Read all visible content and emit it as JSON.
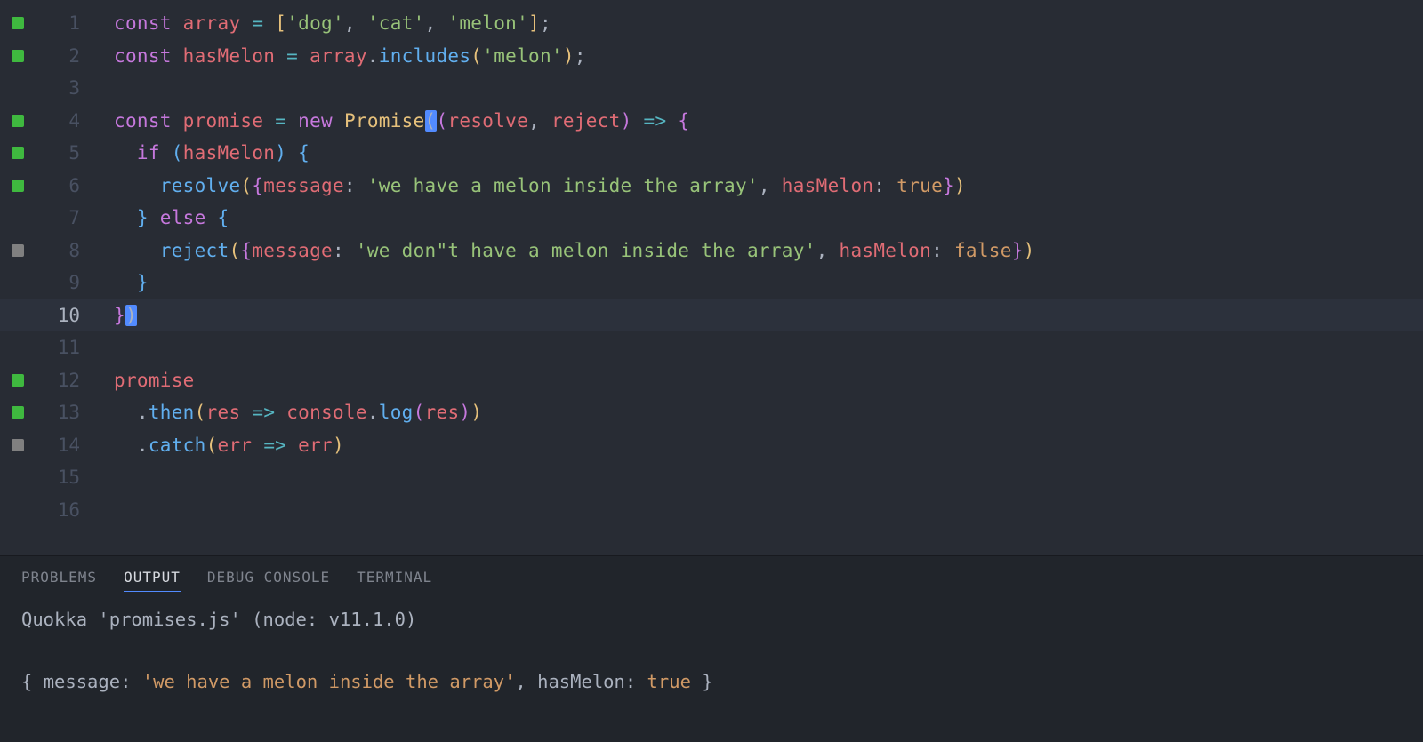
{
  "editor": {
    "lines": [
      {
        "num": 1,
        "indicator": "green"
      },
      {
        "num": 2,
        "indicator": "green"
      },
      {
        "num": 3,
        "indicator": null
      },
      {
        "num": 4,
        "indicator": "green"
      },
      {
        "num": 5,
        "indicator": "green"
      },
      {
        "num": 6,
        "indicator": "green"
      },
      {
        "num": 7,
        "indicator": null
      },
      {
        "num": 8,
        "indicator": "gray"
      },
      {
        "num": 9,
        "indicator": null
      },
      {
        "num": 10,
        "indicator": null,
        "current": true
      },
      {
        "num": 11,
        "indicator": null
      },
      {
        "num": 12,
        "indicator": "green"
      },
      {
        "num": 13,
        "indicator": "green"
      },
      {
        "num": 14,
        "indicator": "gray"
      },
      {
        "num": 15,
        "indicator": null
      },
      {
        "num": 16,
        "indicator": null
      }
    ],
    "code": {
      "l1": {
        "const": "const",
        "array": "array",
        "eq": "=",
        "open": "[",
        "s1": "'dog'",
        "s2": "'cat'",
        "s3": "'melon'",
        "close": "];"
      },
      "l2": {
        "const": "const",
        "hasMelon": "hasMelon",
        "eq": "=",
        "array": "array",
        "dot": ".",
        "includes": "includes",
        "open": "(",
        "s": "'melon'",
        "close": ");"
      },
      "l4": {
        "const": "const",
        "promise": "promise",
        "eq": "=",
        "new": "new",
        "Promise": "Promise",
        "po": "(",
        "po2": "(",
        "resolve": "resolve",
        "comma": ",",
        "reject": "reject",
        "pc": ")",
        "arrow": "=>",
        "brace": "{"
      },
      "l5": {
        "if": "if",
        "open": "(",
        "hasMelon": "hasMelon",
        "close": ")",
        "brace": "{"
      },
      "l6": {
        "resolve": "resolve",
        "open": "(",
        "bopen": "{",
        "message": "message",
        "colon": ":",
        "s": "'we have a melon inside the array'",
        "comma": ",",
        "hasMelon": "hasMelon",
        "colon2": ":",
        "true": "true",
        "bclose": "}",
        "close": ")"
      },
      "l7": {
        "cbrace": "}",
        "else": "else",
        "obrace": "{"
      },
      "l8": {
        "reject": "reject",
        "open": "(",
        "bopen": "{",
        "message": "message",
        "colon": ":",
        "s": "'we don\"t have a melon inside the array'",
        "comma": ",",
        "hasMelon": "hasMelon",
        "colon2": ":",
        "false": "false",
        "bclose": "}",
        "close": ")"
      },
      "l9": {
        "cbrace": "}"
      },
      "l10": {
        "cbrace": "}",
        "cparen": ")"
      },
      "l12": {
        "promise": "promise"
      },
      "l13": {
        "dot": ".",
        "then": "then",
        "open": "(",
        "res": "res",
        "arrow": "=>",
        "console": "console",
        "dot2": ".",
        "log": "log",
        "open2": "(",
        "res2": "res",
        "close2": ")",
        "close": ")"
      },
      "l14": {
        "dot": ".",
        "catch": "catch",
        "open": "(",
        "err": "err",
        "arrow": "=>",
        "err2": "err",
        "close": ")"
      }
    }
  },
  "panel": {
    "tabs": {
      "problems": "PROBLEMS",
      "output": "OUTPUT",
      "debug": "DEBUG CONSOLE",
      "terminal": "TERMINAL"
    },
    "output": {
      "header": "Quokka 'promises.js' (node: v11.1.0)",
      "blank": "",
      "result_open": "{ ",
      "result_msg_key": "message:",
      "result_msg_val": "'we have a melon inside the array'",
      "result_comma": ", ",
      "result_hm_key": "hasMelon:",
      "result_hm_val": "true",
      "result_close": " }"
    }
  }
}
